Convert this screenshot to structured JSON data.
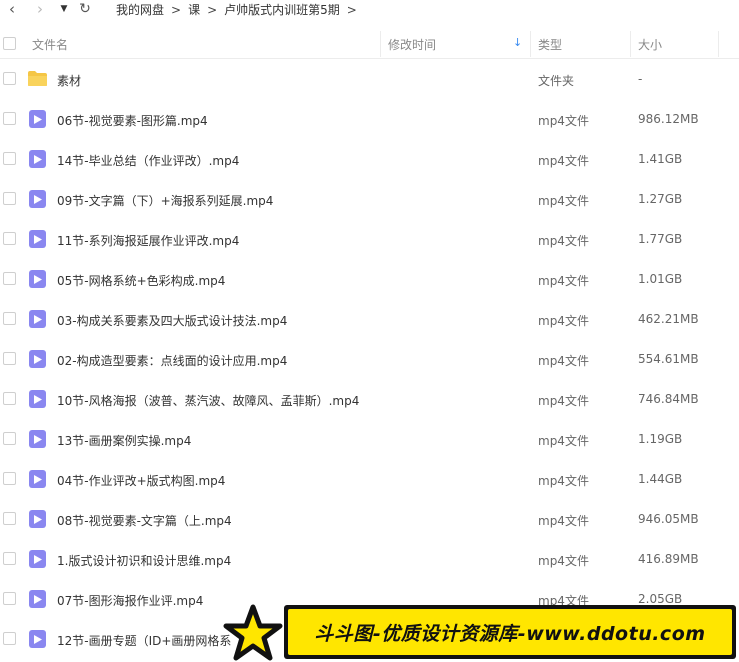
{
  "nav": {
    "back_glyph": "‹",
    "forward_glyph": "›",
    "dropdown_glyph": "▼",
    "refresh_glyph": "↻"
  },
  "breadcrumb": {
    "items": [
      "我的网盘",
      "课",
      "卢帅版式内训班第5期"
    ],
    "separator": ">"
  },
  "header": {
    "name": "文件名",
    "modified": "修改时间",
    "type": "类型",
    "size": "大小",
    "sort_glyph": "↓"
  },
  "files": [
    {
      "name": "素材",
      "type": "文件夹",
      "size": "-",
      "icon": "folder-icon"
    },
    {
      "name": "06节-视觉要素-图形篇.mp4",
      "type": "mp4文件",
      "size": "986.12MB",
      "icon": "video-file-icon"
    },
    {
      "name": "14节-毕业总结（作业评改）.mp4",
      "type": "mp4文件",
      "size": "1.41GB",
      "icon": "video-file-icon"
    },
    {
      "name": "09节-文字篇（下）+海报系列延展.mp4",
      "type": "mp4文件",
      "size": "1.27GB",
      "icon": "video-file-icon"
    },
    {
      "name": "11节-系列海报延展作业评改.mp4",
      "type": "mp4文件",
      "size": "1.77GB",
      "icon": "video-file-icon"
    },
    {
      "name": "05节-网格系统+色彩构成.mp4",
      "type": "mp4文件",
      "size": "1.01GB",
      "icon": "video-file-icon"
    },
    {
      "name": "03-构成关系要素及四大版式设计技法.mp4",
      "type": "mp4文件",
      "size": "462.21MB",
      "icon": "video-file-icon"
    },
    {
      "name": "02-构成造型要素：点线面的设计应用.mp4",
      "type": "mp4文件",
      "size": "554.61MB",
      "icon": "video-file-icon"
    },
    {
      "name": "10节-风格海报（波普、蒸汽波、故障风、孟菲斯）.mp4",
      "type": "mp4文件",
      "size": "746.84MB",
      "icon": "video-file-icon"
    },
    {
      "name": "13节-画册案例实操.mp4",
      "type": "mp4文件",
      "size": "1.19GB",
      "icon": "video-file-icon"
    },
    {
      "name": "04节-作业评改+版式构图.mp4",
      "type": "mp4文件",
      "size": "1.44GB",
      "icon": "video-file-icon"
    },
    {
      "name": "08节-视觉要素-文字篇（上.mp4",
      "type": "mp4文件",
      "size": "946.05MB",
      "icon": "video-file-icon"
    },
    {
      "name": "1.版式设计初识和设计思维.mp4",
      "type": "mp4文件",
      "size": "416.89MB",
      "icon": "video-file-icon"
    },
    {
      "name": "07节-图形海报作业评.mp4",
      "type": "mp4文件",
      "size": "2.05GB",
      "icon": "video-file-icon"
    },
    {
      "name": "12节-画册专题（ID+画册网格系",
      "type": "",
      "size": "",
      "icon": "video-file-icon"
    }
  ],
  "watermark": {
    "text": "斗斗图-优质设计资源库-www.ddotu.com"
  },
  "colors": {
    "video_icon": "#8a87f0",
    "folder_icon": "#f5c645",
    "sort_accent": "#3b8cf0",
    "banner_yellow": "#ffe600"
  }
}
